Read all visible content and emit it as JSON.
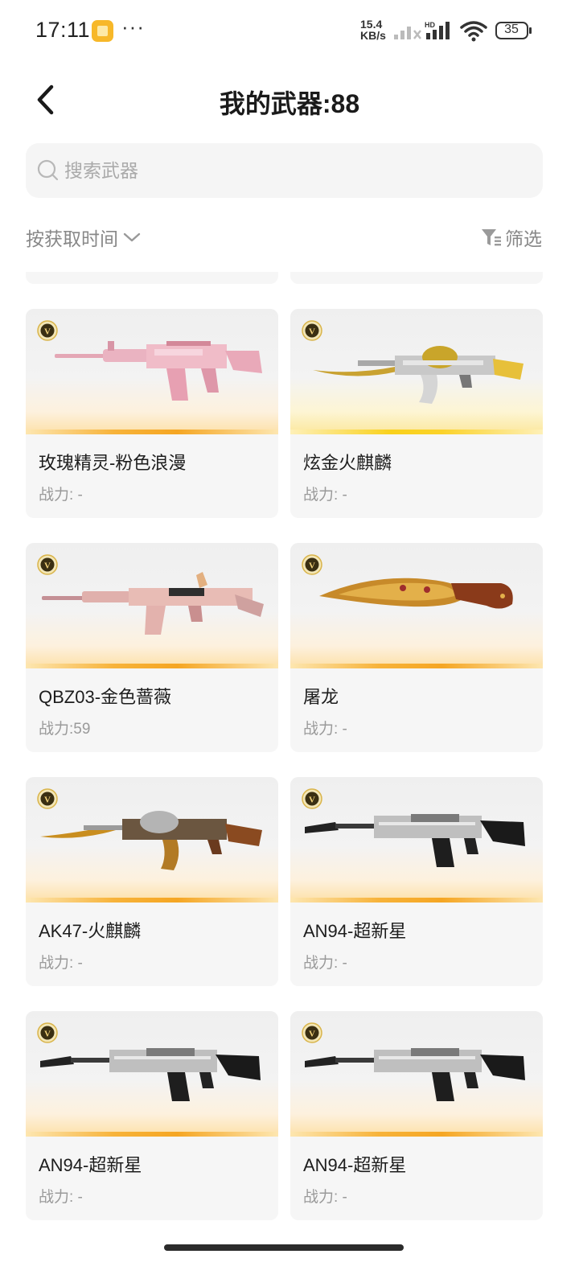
{
  "status_bar": {
    "time": "17:11",
    "more": "···",
    "speed_value": "15.4",
    "speed_unit": "KB/s",
    "network_label": "HD",
    "battery": "35"
  },
  "header": {
    "title": "我的武器:88"
  },
  "search": {
    "placeholder": "搜索武器",
    "value": ""
  },
  "toolbar": {
    "sort_label": "按获取时间",
    "filter_label": "筛选"
  },
  "colors": {
    "accent_orange": "#f5a623",
    "accent_gold": "#f9d11c",
    "card_bg": "#f6f6f6",
    "text_secondary": "#9a9a9a"
  },
  "weapons": [
    {
      "name": "玫瑰精灵-粉色浪漫",
      "power": "战力: -",
      "art": "pink-rifle-icon",
      "tint": "orange"
    },
    {
      "name": "炫金火麒麟",
      "power": "战力: -",
      "art": "gold-ak-icon",
      "tint": "gold"
    },
    {
      "name": "QBZ03-金色蔷薇",
      "power": "战力:59",
      "art": "rose-rifle-icon",
      "tint": "orange"
    },
    {
      "name": "屠龙",
      "power": "战力: -",
      "art": "dragon-blade-icon",
      "tint": "orange"
    },
    {
      "name": "AK47-火麒麟",
      "power": "战力: -",
      "art": "fire-ak-icon",
      "tint": "orange"
    },
    {
      "name": "AN94-超新星",
      "power": "战力: -",
      "art": "an94-rifle-icon",
      "tint": "orange"
    },
    {
      "name": "AN94-超新星",
      "power": "战力: -",
      "art": "an94-rifle-icon",
      "tint": "orange"
    },
    {
      "name": "AN94-超新星",
      "power": "战力: -",
      "art": "an94-rifle-icon",
      "tint": "orange"
    }
  ]
}
